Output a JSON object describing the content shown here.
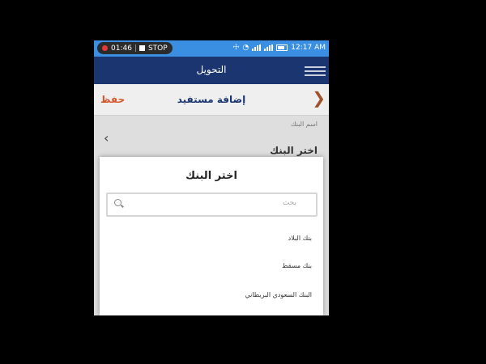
{
  "status_bar": {
    "timer": "01:46",
    "stop_label": "STOP",
    "time": "12:17 AM"
  },
  "app_bar": {
    "title": "التحويل"
  },
  "sub_bar": {
    "save_label": "حفظ",
    "title": "إضافة مستفيد"
  },
  "form": {
    "bank_field_label": "اسم البنك",
    "bank_field_value": "اختر البنك"
  },
  "dialog": {
    "title": "اختر البنك",
    "search_placeholder": "بحث",
    "banks": [
      "بنك البلاد",
      "بنك مسقط",
      "البنك السعودي البريطاني"
    ]
  },
  "colors": {
    "status_bar": "#3b8fe3",
    "app_bar": "#1a3570",
    "save_accent": "#d4572a"
  }
}
